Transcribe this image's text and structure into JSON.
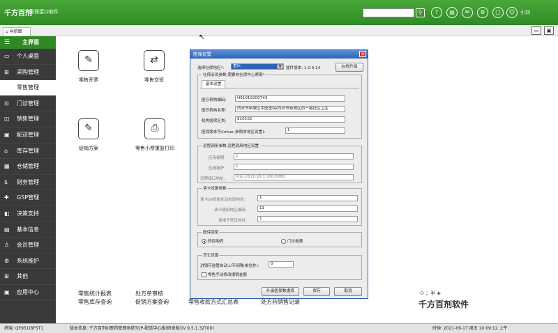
{
  "app": {
    "logo": "千方百剂",
    "title": "医保接口软件",
    "user": "小刘"
  },
  "topbar_icons": [
    "help-icon",
    "document-icon",
    "mail-icon",
    "settings-icon",
    "lock-icon"
  ],
  "tab": {
    "label": "导航图"
  },
  "sidebar": {
    "head": "主界面",
    "items": [
      {
        "label": "个人桌面"
      },
      {
        "label": "采购管理"
      },
      {
        "label": "零售管理"
      },
      {
        "label": "门诊管理"
      },
      {
        "label": "销售管理"
      },
      {
        "label": "配送管理"
      },
      {
        "label": "库存管理"
      },
      {
        "label": "仓储管理"
      },
      {
        "label": "财务管理"
      },
      {
        "label": "GSP管理"
      },
      {
        "label": "决策支持"
      },
      {
        "label": "基本信息"
      },
      {
        "label": "会员管理"
      },
      {
        "label": "系统维护"
      },
      {
        "label": "其他"
      },
      {
        "label": "应用中心"
      }
    ]
  },
  "modules": [
    {
      "label": "零售开票"
    },
    {
      "label": "零售交班"
    },
    {
      "label": "促销方案"
    },
    {
      "label": "零售小票重复打印"
    }
  ],
  "links": [
    "零售统计报表",
    "零售库存查询",
    "处方单审核",
    "促销方案查询",
    "零售收款方式汇总表",
    "处方药销售记录"
  ],
  "status": {
    "host": "终端: QF951IBFST1",
    "version": "版本信息: 千方百剂III医药管理系统TOP-配送中心版(研发版)(V 9.5.1.32T00)",
    "time": "时钟: 2021-09-17 周五 10:09:12 上午"
  },
  "watermark": "千方百剂软件",
  "dialog": {
    "title": "医保设置",
    "region_label": "选择社保地区*:",
    "region_value": "重庆",
    "plugin_version": "插件版本: 1.0.9.14",
    "upgrade_online": "在线升级",
    "required_note": "社保必设参数,需要向社保中心索取*",
    "basic_tab": "基本设置",
    "org_code_label": "医疗机构编码:",
    "org_code": "H61010200743",
    "org_name_label": "医疗机构名称:",
    "org_name": "西安市新城区中医医院(西安市新城区西一路社区卫生",
    "area_label": "机构医保区划:",
    "area": "610102",
    "version_label": "医保版本号(infver,参照本地区设置):",
    "version": "1",
    "remote_group": "远程调用参数,远程调用地区设置",
    "app_id_label": "应用秘钥:",
    "app_id": "1",
    "app_key_label": "应用秘护:",
    "app_key": "1",
    "remote_url_label": "远程接口地址:",
    "remote_url": "http://172.16.1.200:8080",
    "card_group": "读卡设置参数",
    "card_init_label": "读卡dll初始化动态库地址:",
    "card_init": "1",
    "card_region_label": "读卡使用地区编码:",
    "card_region": "11",
    "card_cert_label": "读电子凭证地址:",
    "card_cert": "1",
    "type_group": "医保类型",
    "type_pharmacy": "药店购药",
    "type_clinic": "门诊收费",
    "other_group": "其它设置",
    "upload_label": "进销存监管自动上传间隔(单位秒):",
    "upload": "0",
    "manual_amount": "零售手动修改报销金额",
    "btn_db": "升级医保数据库",
    "btn_save": "保存",
    "btn_cancel": "取消"
  }
}
